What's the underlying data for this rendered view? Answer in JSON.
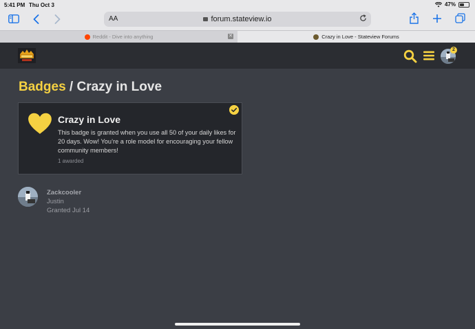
{
  "status_bar": {
    "time": "5:41 PM",
    "date": "Thu Oct 3",
    "battery": "47%",
    "battery_level": 0.47
  },
  "browser": {
    "aa_label": "AA",
    "url": "forum.stateview.io",
    "icons": [
      "sidebar-icon",
      "back-icon",
      "forward-icon",
      "lock-icon",
      "reload-icon",
      "share-icon",
      "new-tab-icon",
      "tabs-icon"
    ],
    "tabs": [
      {
        "label": "Reddit - Dive into anything",
        "active": false
      },
      {
        "label": "Crazy in Love - Stateview Forums",
        "active": true
      }
    ]
  },
  "site_header": {
    "notification_count": "2",
    "colors": {
      "bg": "#2b2d32",
      "accent": "#f5d142"
    }
  },
  "breadcrumb": {
    "link": "Badges",
    "separator": " / ",
    "current": "Crazy in Love"
  },
  "badge": {
    "title": "Crazy in Love",
    "description": "This badge is granted when you use all 50 of your daily likes for 20 days. Wow! You’re a role model for encouraging your fellow community members!",
    "awarded": "1 awarded",
    "icon": "heart-icon",
    "color": "#f5d142"
  },
  "grants": [
    {
      "username": "Zackcooler",
      "title": "Justin",
      "granted": "Granted Jul 14"
    }
  ]
}
